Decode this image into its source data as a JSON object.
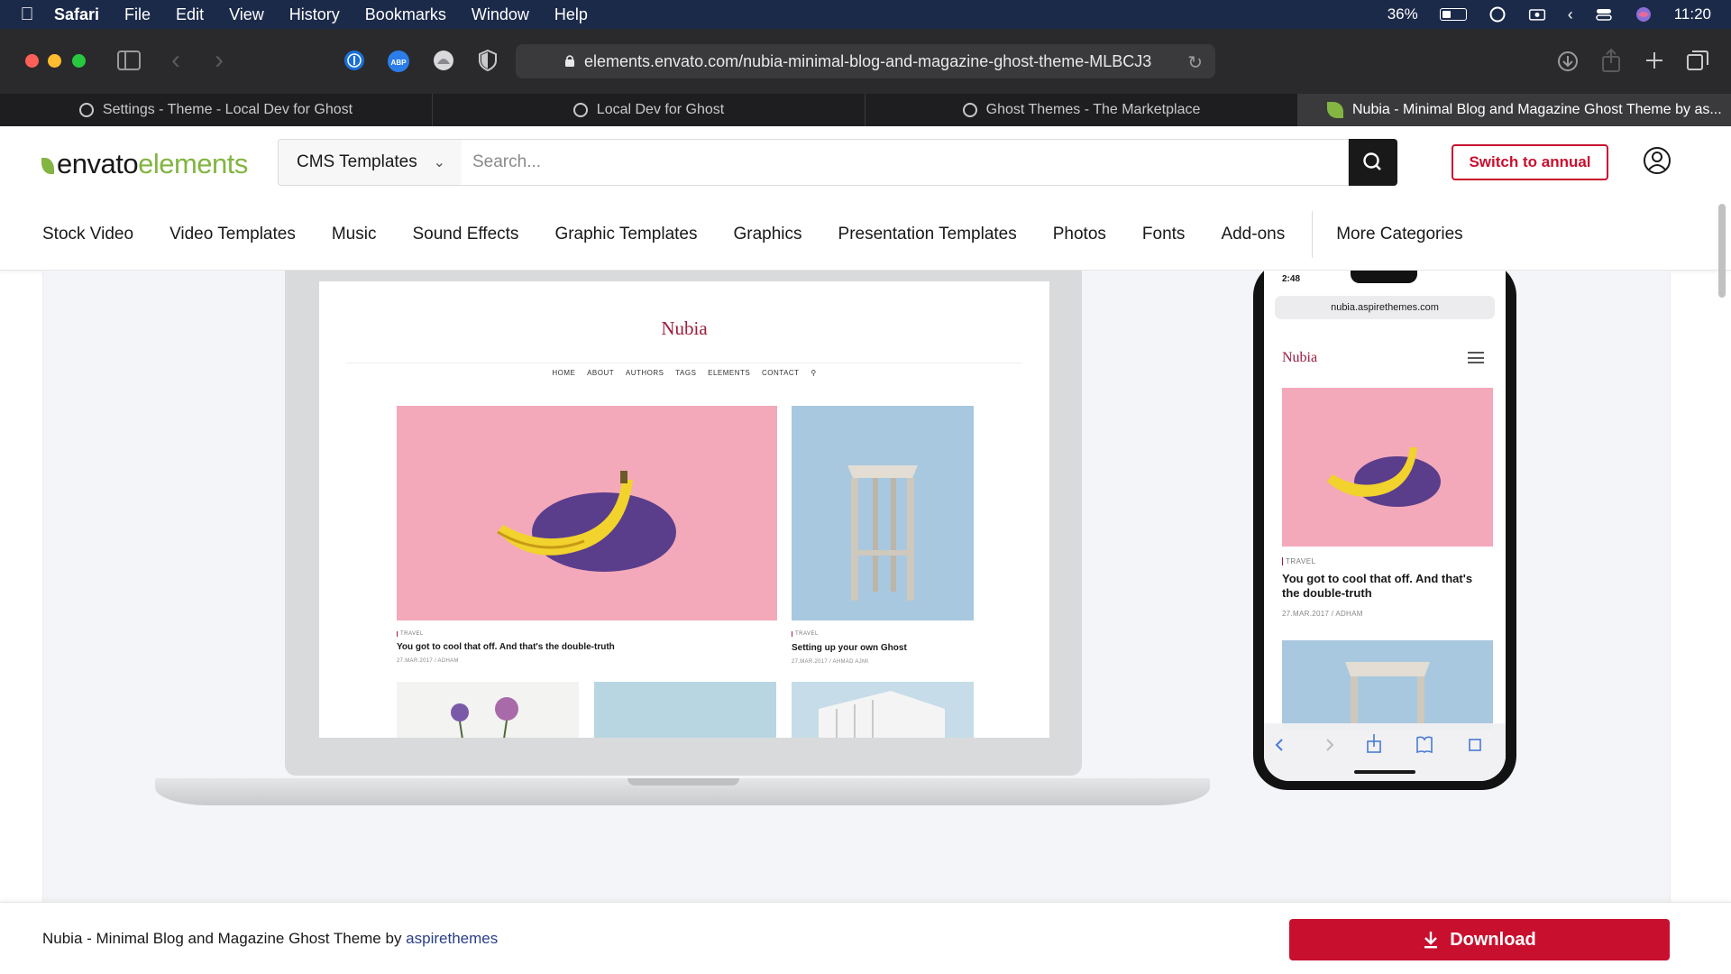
{
  "menubar": {
    "app": "Safari",
    "items": [
      "File",
      "Edit",
      "View",
      "History",
      "Bookmarks",
      "Window",
      "Help"
    ],
    "battery": "36%",
    "time": "11:20"
  },
  "browser": {
    "url": "elements.envato.com/nubia-minimal-blog-and-magazine-ghost-theme-MLBCJ3",
    "tabs": [
      {
        "label": "Settings - Theme - Local Dev for Ghost"
      },
      {
        "label": "Local Dev for Ghost"
      },
      {
        "label": "Ghost Themes - The Marketplace"
      },
      {
        "label": "Nubia - Minimal Blog and Magazine Ghost Theme by as..."
      }
    ]
  },
  "header": {
    "logo_main": "envato",
    "logo_accent": "elements",
    "category_select": "CMS Templates",
    "search_placeholder": "Search...",
    "switch_button": "Switch to annual"
  },
  "nav": {
    "items": [
      "Stock Video",
      "Video Templates",
      "Music",
      "Sound Effects",
      "Graphic Templates",
      "Graphics",
      "Presentation Templates",
      "Photos",
      "Fonts",
      "Add-ons"
    ],
    "more": "More Categories"
  },
  "preview": {
    "laptop": {
      "blog_title": "Nubia",
      "blog_nav": [
        "HOME",
        "ABOUT",
        "AUTHORS",
        "TAGS",
        "ELEMENTS",
        "CONTACT"
      ],
      "post1": {
        "tag": "TRAVEL",
        "title": "You got to cool that off. And that's the double-truth",
        "meta": "27.MAR.2017  /  ADHAM"
      },
      "post2": {
        "tag": "TRAVEL",
        "title": "Setting up your own Ghost",
        "meta": "27.MAR.2017  /  AHMAD AJMI"
      }
    },
    "phone": {
      "time": "2:48",
      "url": "nubia.aspirethemes.com",
      "blog_title": "Nubia",
      "post": {
        "tag": "TRAVEL",
        "title": "You got to cool that off. And that's the double-truth",
        "meta": "27.MAR.2017  /  ADHAM"
      }
    }
  },
  "footer": {
    "item_title": "Nubia - Minimal Blog and Magazine Ghost Theme by ",
    "author": "aspirethemes",
    "download_label": "Download"
  },
  "colors": {
    "brand_green": "#82b541",
    "accent_red": "#c8102e",
    "blog_accent": "#9b1c3d"
  }
}
